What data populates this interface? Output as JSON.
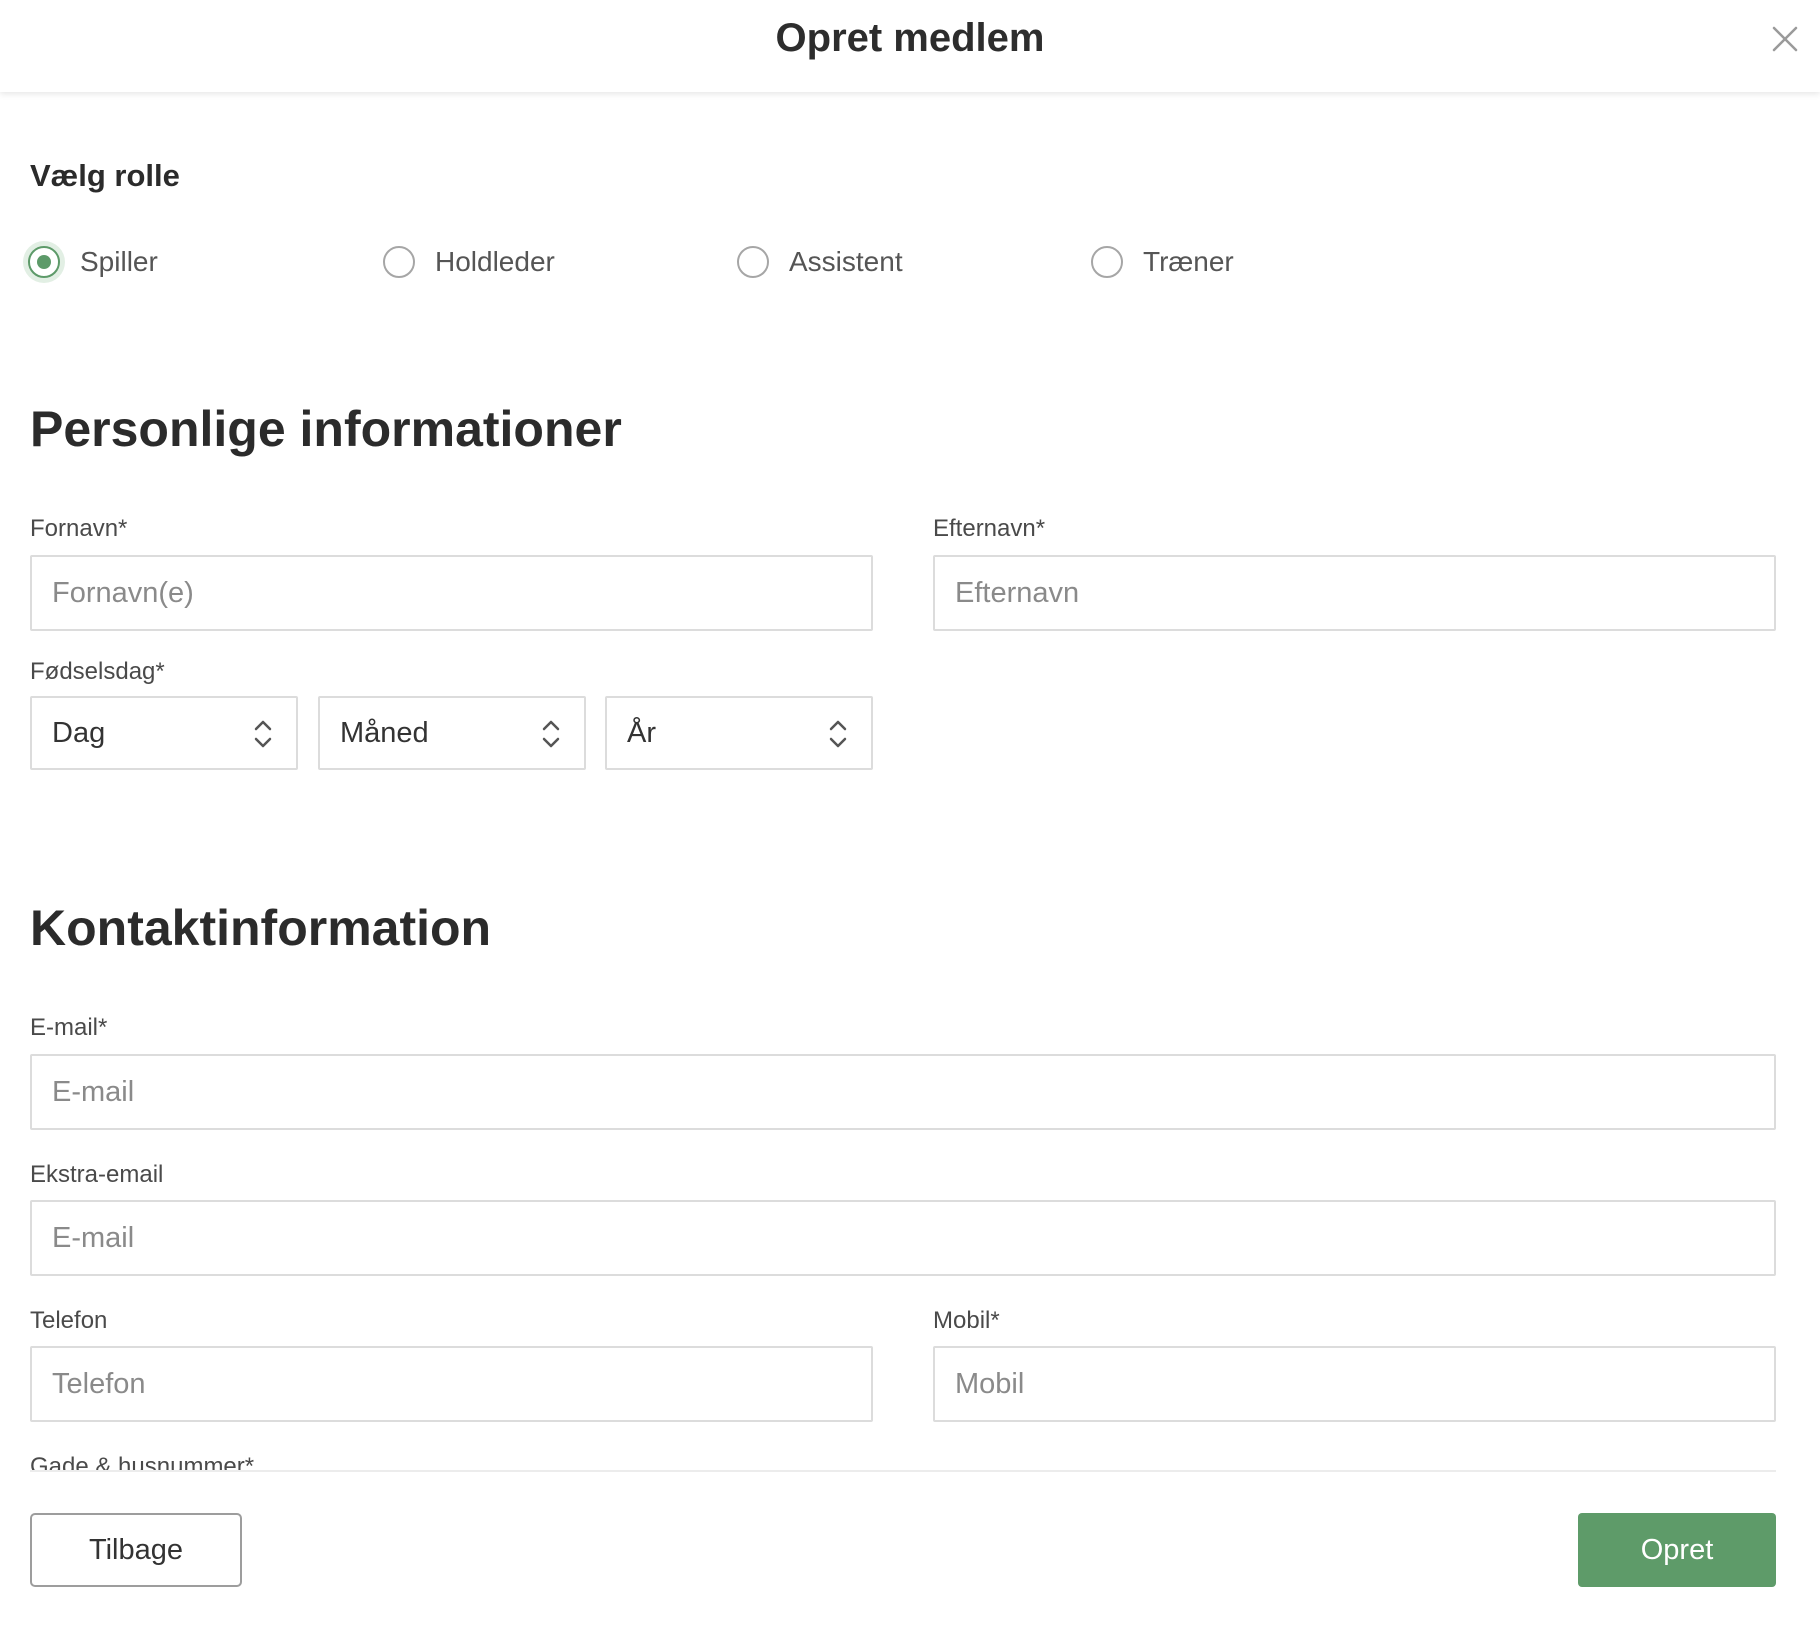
{
  "header": {
    "title": "Opret medlem",
    "close_icon": "close-icon"
  },
  "role": {
    "label": "Vælg rolle",
    "options": [
      "Spiller",
      "Holdleder",
      "Assistent",
      "Træner"
    ],
    "selected": "Spiller"
  },
  "personal": {
    "title": "Personlige informationer",
    "first_name": {
      "label": "Fornavn",
      "required_mark": "*",
      "placeholder": "Fornavn(e)"
    },
    "last_name": {
      "label": "Efternavn",
      "required_mark": "*",
      "placeholder": "Efternavn"
    },
    "birthday": {
      "label": "Fødselsdag",
      "required_mark": "*",
      "day": "Dag",
      "month": "Måned",
      "year": "År"
    }
  },
  "contact": {
    "title": "Kontaktinformation",
    "email": {
      "label": "E-mail",
      "required_mark": "*",
      "placeholder": "E-mail"
    },
    "extra_email": {
      "label": "Ekstra-email",
      "placeholder": "E-mail"
    },
    "phone": {
      "label": "Telefon",
      "placeholder": "Telefon"
    },
    "mobile": {
      "label": "Mobil",
      "required_mark": "*",
      "placeholder": "Mobil"
    },
    "street": {
      "label": "Gade & husnummer",
      "required_mark": "*"
    }
  },
  "footer": {
    "back_label": "Tilbage",
    "create_label": "Opret"
  },
  "colors": {
    "accent": "#5e9b69",
    "border": "#dcdcdc",
    "text": "#2b2b2b"
  }
}
